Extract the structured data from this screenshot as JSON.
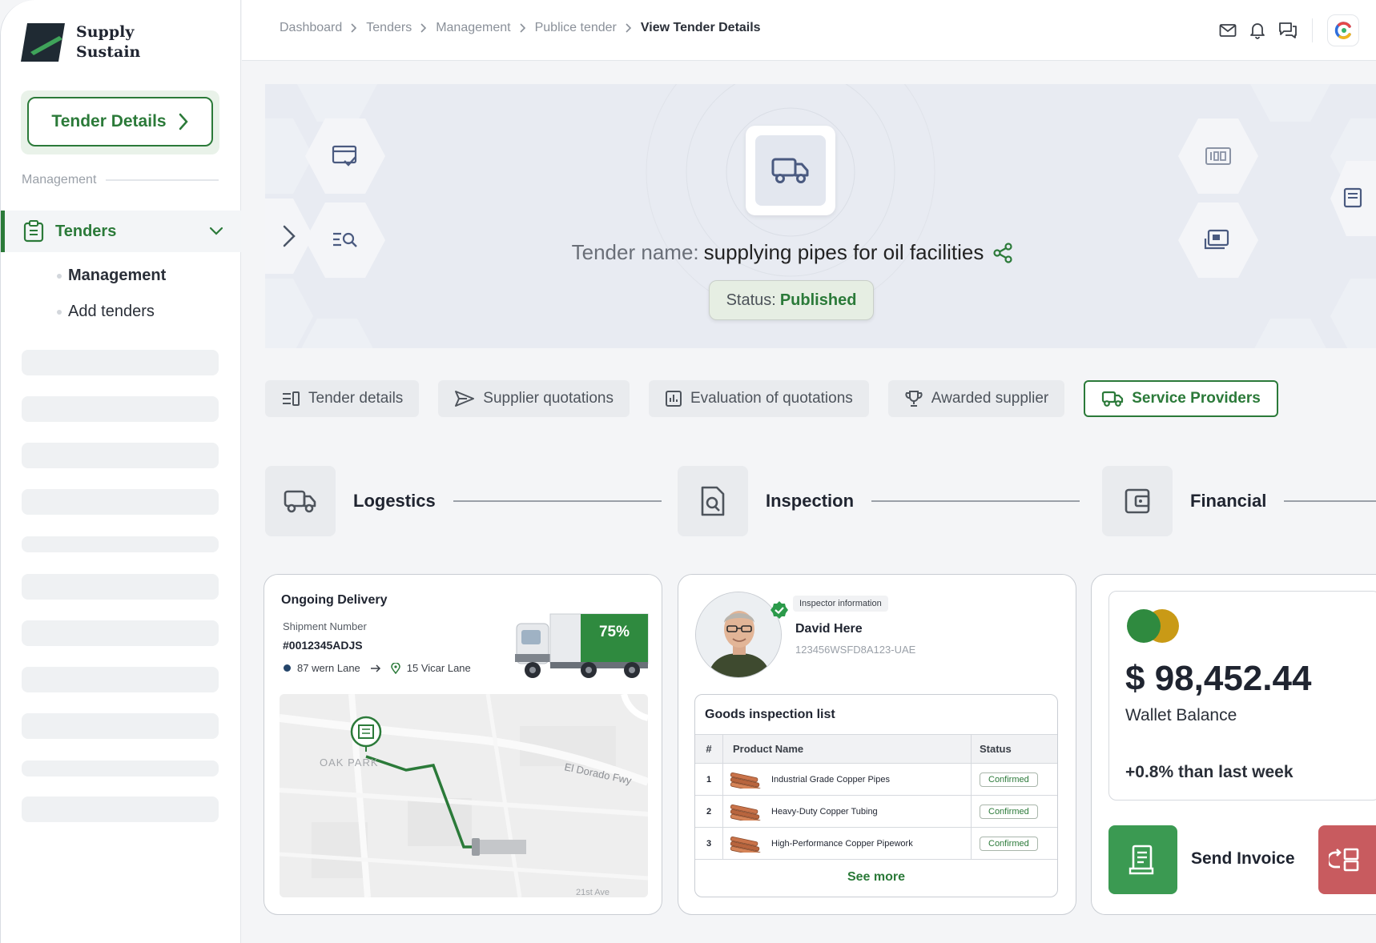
{
  "brand": {
    "line1": "Supply",
    "line2": "Sustain"
  },
  "sidebar": {
    "cta_label": "Tender Details",
    "section_label": "Management",
    "nav_tenders": "Tenders",
    "sub_items": [
      "Management",
      "Add tenders"
    ]
  },
  "breadcrumb": [
    "Dashboard",
    "Tenders",
    "Management",
    "Publice tender",
    "View Tender Details"
  ],
  "hero": {
    "name_label": "Tender name:",
    "name_value": "supplying pipes for oil facilities",
    "status_label": "Status:",
    "status_value": "Published"
  },
  "tabs": [
    "Tender details",
    "Supplier quotations",
    "Evaluation of quotations",
    "Awarded supplier",
    "Service Providers"
  ],
  "stages": [
    "Logestics",
    "Inspection",
    "Financial"
  ],
  "delivery": {
    "title": "Ongoing Delivery",
    "shipment_label": "Shipment Number",
    "shipment_number": "#0012345ADJS",
    "from": "87 wern Lane",
    "to": "15 Vicar Lane",
    "progress": "75%",
    "map_labels": {
      "area": "OAK PARK",
      "road": "El Dorado Fwy",
      "street": "21st Ave"
    }
  },
  "inspector": {
    "chip": "Inspector information",
    "name": "David Here",
    "id": "123456WSFD8A123-UAE"
  },
  "goods": {
    "title": "Goods inspection list",
    "headers": [
      "#",
      "Product Name",
      "Status"
    ],
    "rows": [
      {
        "num": "1",
        "name": "Industrial Grade Copper Pipes",
        "status": "Confirmed"
      },
      {
        "num": "2",
        "name": "Heavy-Duty Copper Tubing",
        "status": "Confirmed"
      },
      {
        "num": "3",
        "name": "High-Performance Copper Pipework",
        "status": "Confirmed"
      }
    ],
    "see_more": "See more"
  },
  "wallet": {
    "balance": "$ 98,452.44",
    "label": "Wallet Balance",
    "change": "+0.8% than last week",
    "send_invoice": "Send Invoice"
  },
  "colors": {
    "brand_green": "#2b7a39",
    "invoice_green": "#3b9a52",
    "danger": "#c85b5f"
  }
}
